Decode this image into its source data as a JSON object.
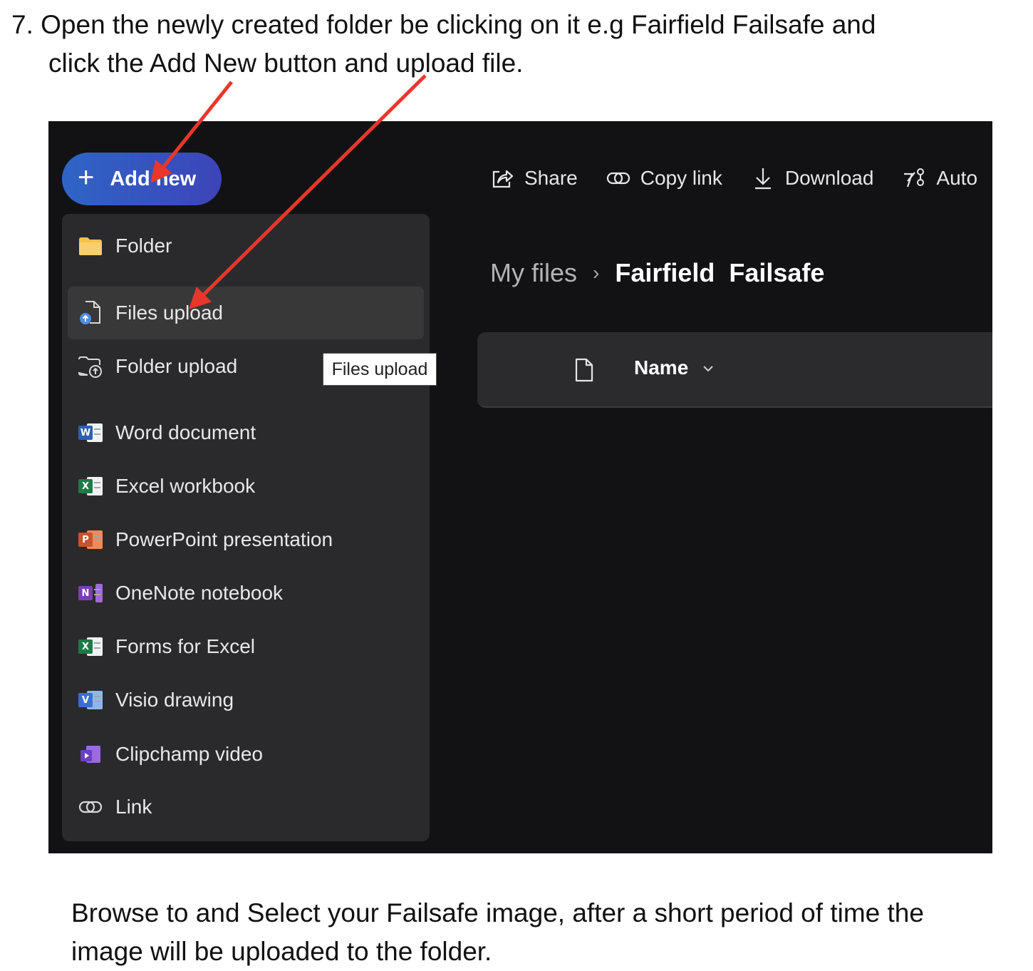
{
  "instructions": {
    "step_line1": "7.  Open the newly created folder be clicking on it e.g Fairfield Failsafe and",
    "step_line2": "click the Add New button and upload file.",
    "note_line1": "Browse to and Select your Failsafe image, after a short period of time the",
    "note_line2": "image will be uploaded to the folder."
  },
  "screenshot": {
    "add_new_label": "Add new",
    "menu_items": [
      {
        "label": "Folder",
        "icon": "folder-icon"
      },
      {
        "label": "Files upload",
        "icon": "file-upload-icon"
      },
      {
        "label": "Folder upload",
        "icon": "folder-upload-icon"
      },
      {
        "label": "Word document",
        "icon": "word-icon"
      },
      {
        "label": "Excel workbook",
        "icon": "excel-icon"
      },
      {
        "label": "PowerPoint presentation",
        "icon": "powerpoint-icon"
      },
      {
        "label": "OneNote notebook",
        "icon": "onenote-icon"
      },
      {
        "label": "Forms for Excel",
        "icon": "excel-icon"
      },
      {
        "label": "Visio drawing",
        "icon": "visio-icon"
      },
      {
        "label": "Clipchamp video",
        "icon": "clipchamp-icon"
      },
      {
        "label": "Link",
        "icon": "link-icon"
      }
    ],
    "tooltip": "Files upload",
    "toolbar": {
      "share": "Share",
      "copy_link": "Copy link",
      "download": "Download",
      "automate": "Auto"
    },
    "breadcrumb": {
      "root": "My files",
      "separator": "›",
      "current": "Fairfield  Failsafe"
    },
    "column_header": {
      "name": "Name"
    }
  },
  "colors": {
    "accent_gradient_start": "#2f65c6",
    "accent_gradient_end": "#3d44b8",
    "annotation_arrow": "#e8372a",
    "word": "#2b5fb8",
    "excel": "#1d7a45",
    "powerpoint": "#c9532c",
    "onenote": "#7b3fb5",
    "visio": "#3a6fd0",
    "folder": "#f5c24a"
  }
}
